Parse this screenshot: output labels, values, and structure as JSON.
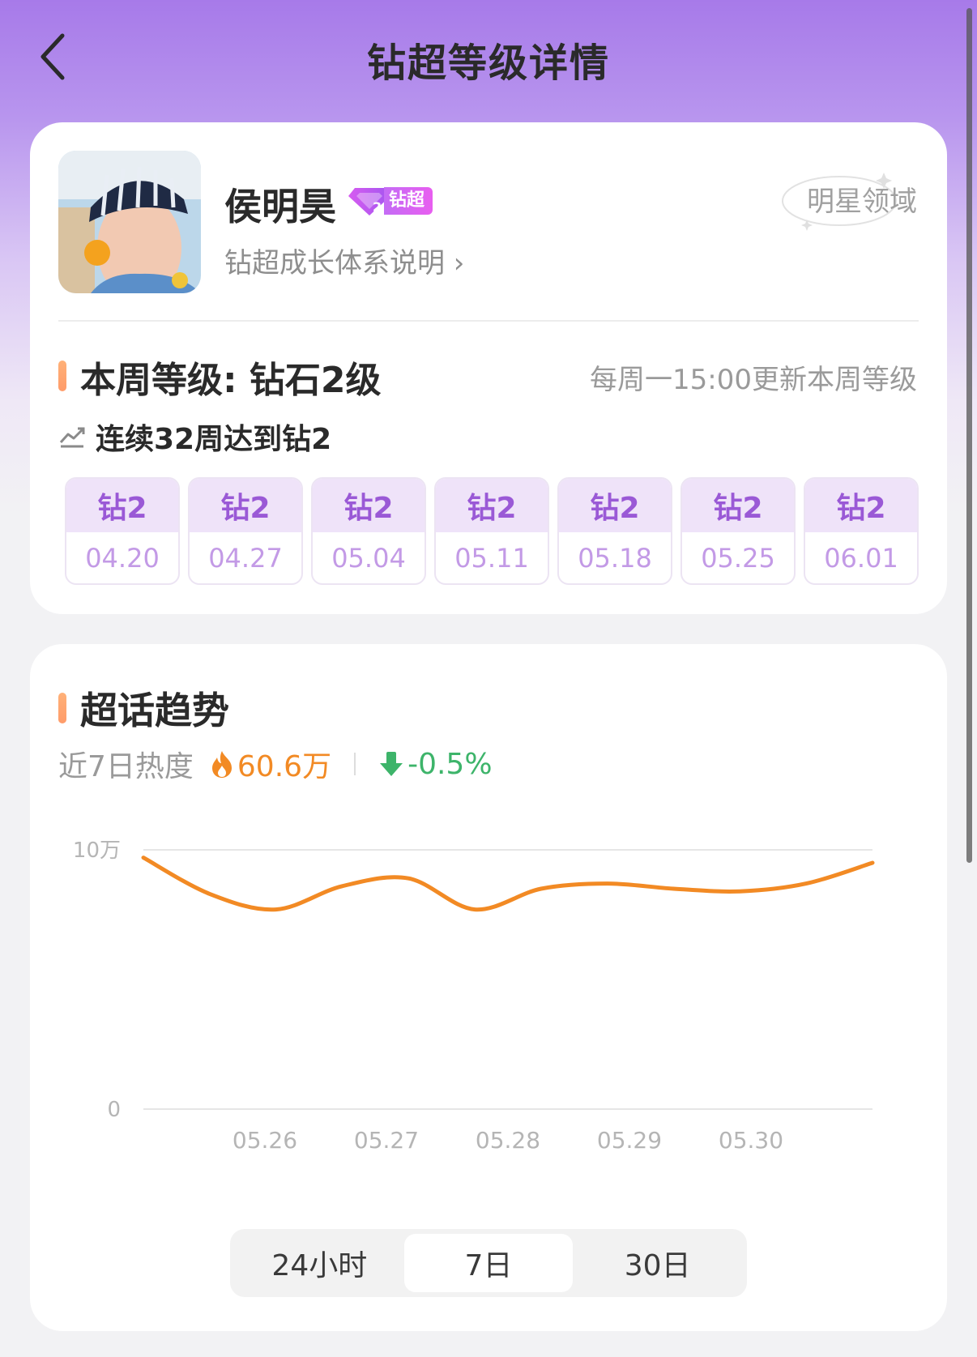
{
  "header": {
    "title": "钻超等级详情"
  },
  "profile": {
    "name": "侯明昊",
    "badge_label": "钻超",
    "growth_link": "钻超成长体系说明 ›",
    "domain": "明星领域"
  },
  "level": {
    "title": "本周等级: 钻石2级",
    "update_note": "每周一15:00更新本周等级",
    "streak": "连续32周达到钻2",
    "weeks": [
      {
        "level": "钻2",
        "date": "04.20"
      },
      {
        "level": "钻2",
        "date": "04.27"
      },
      {
        "level": "钻2",
        "date": "05.04"
      },
      {
        "level": "钻2",
        "date": "05.11"
      },
      {
        "level": "钻2",
        "date": "05.18"
      },
      {
        "level": "钻2",
        "date": "05.25"
      },
      {
        "level": "钻2",
        "date": "06.01"
      }
    ]
  },
  "trend": {
    "title": "超话趋势",
    "heat_label": "近7日热度",
    "heat_value": "60.6万",
    "heat_change": "-0.5%",
    "ranges": [
      "24小时",
      "7日",
      "30日"
    ],
    "active_range": "7日"
  },
  "colors": {
    "accent_purple": "#a77ae9",
    "line_orange": "#f28a24",
    "down_green": "#3db46a"
  },
  "chart_data": {
    "type": "line",
    "x_tick_labels": [
      "05.26",
      "05.27",
      "05.28",
      "05.29",
      "05.30"
    ],
    "y_tick_labels": [
      "10万",
      "0"
    ],
    "ylim": [
      0,
      100000
    ],
    "series": [
      {
        "values": [
          97000,
          83000,
          77000,
          86000,
          89000,
          77000,
          85000,
          87000,
          85000,
          84000,
          87000,
          95000
        ]
      }
    ],
    "grid": true
  }
}
